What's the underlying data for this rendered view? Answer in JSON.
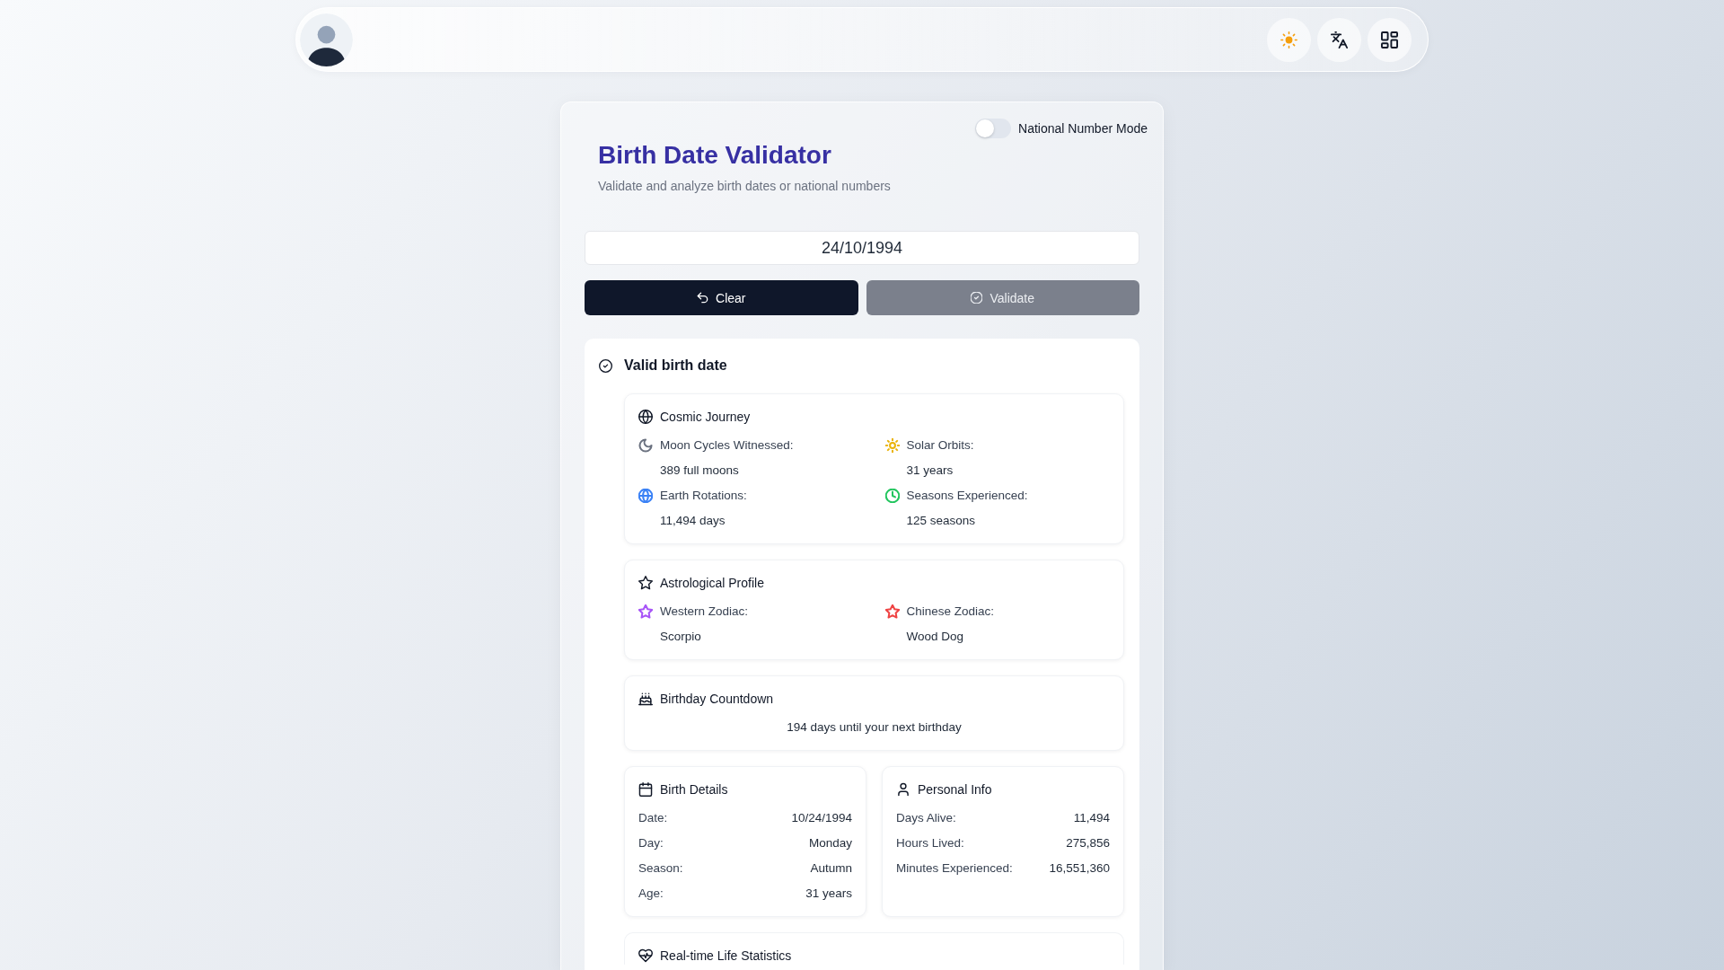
{
  "validator": {
    "mode_toggle": {
      "label": "National Number Mode",
      "on": false
    },
    "title": "Birth Date Validator",
    "subtitle": "Validate and analyze birth dates or national numbers",
    "date_field": {
      "value": "24/10/1994"
    },
    "buttons": [
      {
        "label": "Clear",
        "disabled": false
      },
      {
        "label": "Validate",
        "disabled": true
      }
    ]
  },
  "result": {
    "title": "Valid birth date",
    "sections": [
      {
        "kind": "stats",
        "title": "Cosmic Journey",
        "items": [
          {
            "label": "Moon Cycles Witnessed:",
            "value": "389 full moons",
            "color": "#6b7280"
          },
          {
            "label": "Solar Orbits:",
            "value": "31 years",
            "color": "#eab308"
          },
          {
            "label": "Earth Rotations:",
            "value": "11,494 days",
            "color": "#3b82f6"
          },
          {
            "label": "Seasons Experienced:",
            "value": "125 seasons",
            "color": "#22c55e"
          }
        ]
      },
      {
        "kind": "stats",
        "title": "Astrological Profile",
        "items": [
          {
            "label": "Western Zodiac:",
            "value": "Scorpio",
            "color": "#a855f7"
          },
          {
            "label": "Chinese Zodiac:",
            "value": "Wood Dog",
            "color": "#ef4444"
          }
        ]
      },
      {
        "kind": "text",
        "title": "Birthday Countdown",
        "text": "194 days until your next birthday"
      },
      {
        "kind": "details",
        "title": "Birth Details",
        "rows": [
          {
            "label": "Date:",
            "value": "10/24/1994"
          },
          {
            "label": "Day:",
            "value": "Monday"
          },
          {
            "label": "Season:",
            "value": "Autumn"
          },
          {
            "label": "Age:",
            "value": "31 years"
          }
        ]
      },
      {
        "kind": "details",
        "title": "Personal Info",
        "rows": [
          {
            "label": "Days Alive:",
            "value": "11,494"
          },
          {
            "label": "Hours Lived:",
            "value": "275,856"
          },
          {
            "label": "Minutes Experienced:",
            "value": "16,551,360"
          }
        ]
      },
      {
        "kind": "stats",
        "title": "Real-time Life Statistics"
      }
    ]
  }
}
